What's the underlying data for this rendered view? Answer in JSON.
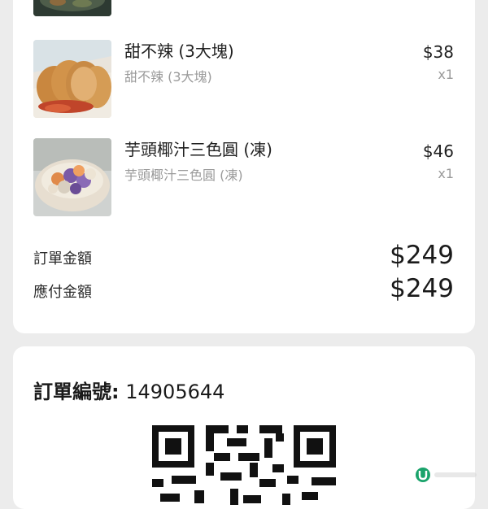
{
  "items": [
    {
      "name": "甜不辣 (3大塊)",
      "subtitle": "甜不辣 (3大塊)",
      "price": "$38",
      "quantity": "x1",
      "image": "tempura-fishcake-photo"
    },
    {
      "name": "芋頭椰汁三色圓 (凍)",
      "subtitle": "芋頭椰汁三色圓 (凍)",
      "price": "$46",
      "quantity": "x1",
      "image": "taro-balls-dessert-photo"
    }
  ],
  "summary": {
    "order_amount_label": "訂單金額",
    "order_amount_value": "$249",
    "payable_amount_label": "應付金額",
    "payable_amount_value": "$249"
  },
  "order": {
    "number_label": "訂單編號:",
    "number_value": "14905644"
  },
  "icons": {
    "qr": "qr-code-icon",
    "watermark": "u-logo-icon"
  },
  "colors": {
    "background": "#ececec",
    "card": "#ffffff",
    "text_primary": "#1a1a1a",
    "text_secondary": "#9a9a9a",
    "watermark_green": "#1aa36b"
  }
}
